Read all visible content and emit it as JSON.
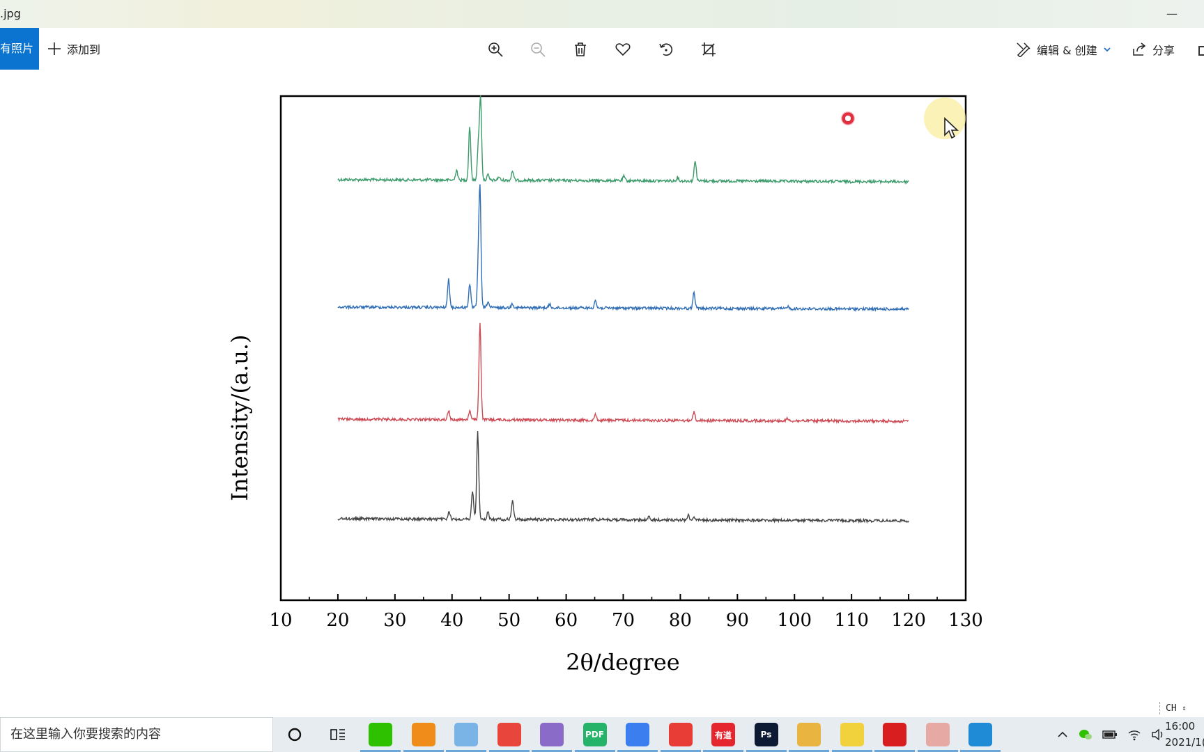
{
  "window": {
    "title": ".jpg",
    "minimize_glyph": "—"
  },
  "toolbar": {
    "all_photos_label": "有照片",
    "add_to_label": "添加到",
    "zoom_in_icon": "zoom-in-icon",
    "zoom_out_icon": "zoom-out-icon",
    "delete_icon": "trash-icon",
    "favorite_icon": "heart-icon",
    "rotate_icon": "rotate-icon",
    "crop_icon": "crop-icon",
    "edit_create_label": "编辑 & 创建",
    "share_label": "分享"
  },
  "chart_data": {
    "type": "line",
    "title": "",
    "xlabel": "2θ/degree",
    "ylabel": "Intensity/(a.u.)",
    "xlim": [
      10,
      130
    ],
    "x_ticks": [
      10,
      20,
      30,
      40,
      50,
      60,
      70,
      80,
      90,
      100,
      110,
      120,
      130
    ],
    "x_tick_labels": [
      "10",
      "20",
      "30",
      "40",
      "50",
      "60",
      "70",
      "80",
      "90",
      "100",
      "110",
      "120",
      "130"
    ],
    "y_ticks_shown": false,
    "grid": false,
    "legend": "none",
    "series": [
      {
        "color": "#3a9a6a",
        "baseline": 3,
        "peaks": [
          [
            40.8,
            0.12
          ],
          [
            43.1,
            0.62
          ],
          [
            44.6,
            0.38
          ],
          [
            45.0,
            0.95
          ],
          [
            46.3,
            0.06
          ],
          [
            48.2,
            0.04
          ],
          [
            50.6,
            0.11
          ],
          [
            70.1,
            0.05
          ],
          [
            79.5,
            0.04
          ],
          [
            82.6,
            0.24
          ]
        ]
      },
      {
        "color": "#2f6db5",
        "baseline": 2,
        "peaks": [
          [
            39.4,
            0.32
          ],
          [
            43.1,
            0.27
          ],
          [
            44.6,
            0.42
          ],
          [
            44.9,
            1.3
          ],
          [
            46.3,
            0.07
          ],
          [
            50.6,
            0.05
          ],
          [
            57.1,
            0.04
          ],
          [
            65.1,
            0.09
          ],
          [
            82.4,
            0.19
          ],
          [
            98.8,
            0.03
          ]
        ]
      },
      {
        "color": "#cc4b55",
        "baseline": 1,
        "peaks": [
          [
            39.4,
            0.1
          ],
          [
            43.1,
            0.1
          ],
          [
            44.9,
            1.12
          ],
          [
            65.1,
            0.07
          ],
          [
            82.4,
            0.1
          ],
          [
            98.8,
            0.03
          ]
        ]
      },
      {
        "color": "#444444",
        "baseline": 0,
        "peaks": [
          [
            39.5,
            0.08
          ],
          [
            43.6,
            0.32
          ],
          [
            44.5,
            1.0
          ],
          [
            46.3,
            0.08
          ],
          [
            50.6,
            0.22
          ],
          [
            65.0,
            0.03
          ],
          [
            74.5,
            0.03
          ],
          [
            81.4,
            0.06
          ],
          [
            82.4,
            0.04
          ]
        ]
      }
    ]
  },
  "overlay": {
    "record_dot_icon": "record-indicator-icon",
    "cursor_icon": "mouse-pointer-icon"
  },
  "ime": {
    "label": "CH"
  },
  "taskbar": {
    "search_placeholder": "在这里输入你要搜索的内容",
    "apps": [
      {
        "name": "cortana-icon",
        "label": "",
        "color": "transparent"
      },
      {
        "name": "task-view-icon",
        "label": "",
        "color": "transparent"
      },
      {
        "name": "wechat-icon",
        "label": "",
        "color": "#2dc100"
      },
      {
        "name": "search-tool-icon",
        "label": "",
        "color": "#f08c1a"
      },
      {
        "name": "file-explorer-window-icon",
        "label": "",
        "color": "#7ab3e6"
      },
      {
        "name": "chrome-icon",
        "label": "",
        "color": "#e8453c"
      },
      {
        "name": "reader-app-icon",
        "label": "",
        "color": "#8a6bc8"
      },
      {
        "name": "pdf-app-icon",
        "label": "PDF",
        "color": "#25b36a"
      },
      {
        "name": "feishu-docs-icon",
        "label": "",
        "color": "#3a7ef0"
      },
      {
        "name": "netease-music-icon",
        "label": "",
        "color": "#e83c36"
      },
      {
        "name": "youdao-icon",
        "label": "有道",
        "color": "#e6262e"
      },
      {
        "name": "photoshop-icon",
        "label": "Ps",
        "color": "#0c1b33"
      },
      {
        "name": "folder-icon",
        "label": "",
        "color": "#e9b440"
      },
      {
        "name": "sticky-notes-icon",
        "label": "",
        "color": "#f2d23c"
      },
      {
        "name": "screen-recorder-icon",
        "label": "",
        "color": "#d81e1e"
      },
      {
        "name": "avatar-app-icon",
        "label": "",
        "color": "#e7a9a4"
      },
      {
        "name": "photos-app-icon",
        "label": "",
        "color": "#1f8ad6"
      }
    ],
    "tray_icons": [
      "chevron-up-icon",
      "wechat-tray-icon",
      "battery-icon",
      "wifi-icon",
      "volume-icon"
    ],
    "clock_time": "16:00",
    "clock_date": "2021/1("
  }
}
